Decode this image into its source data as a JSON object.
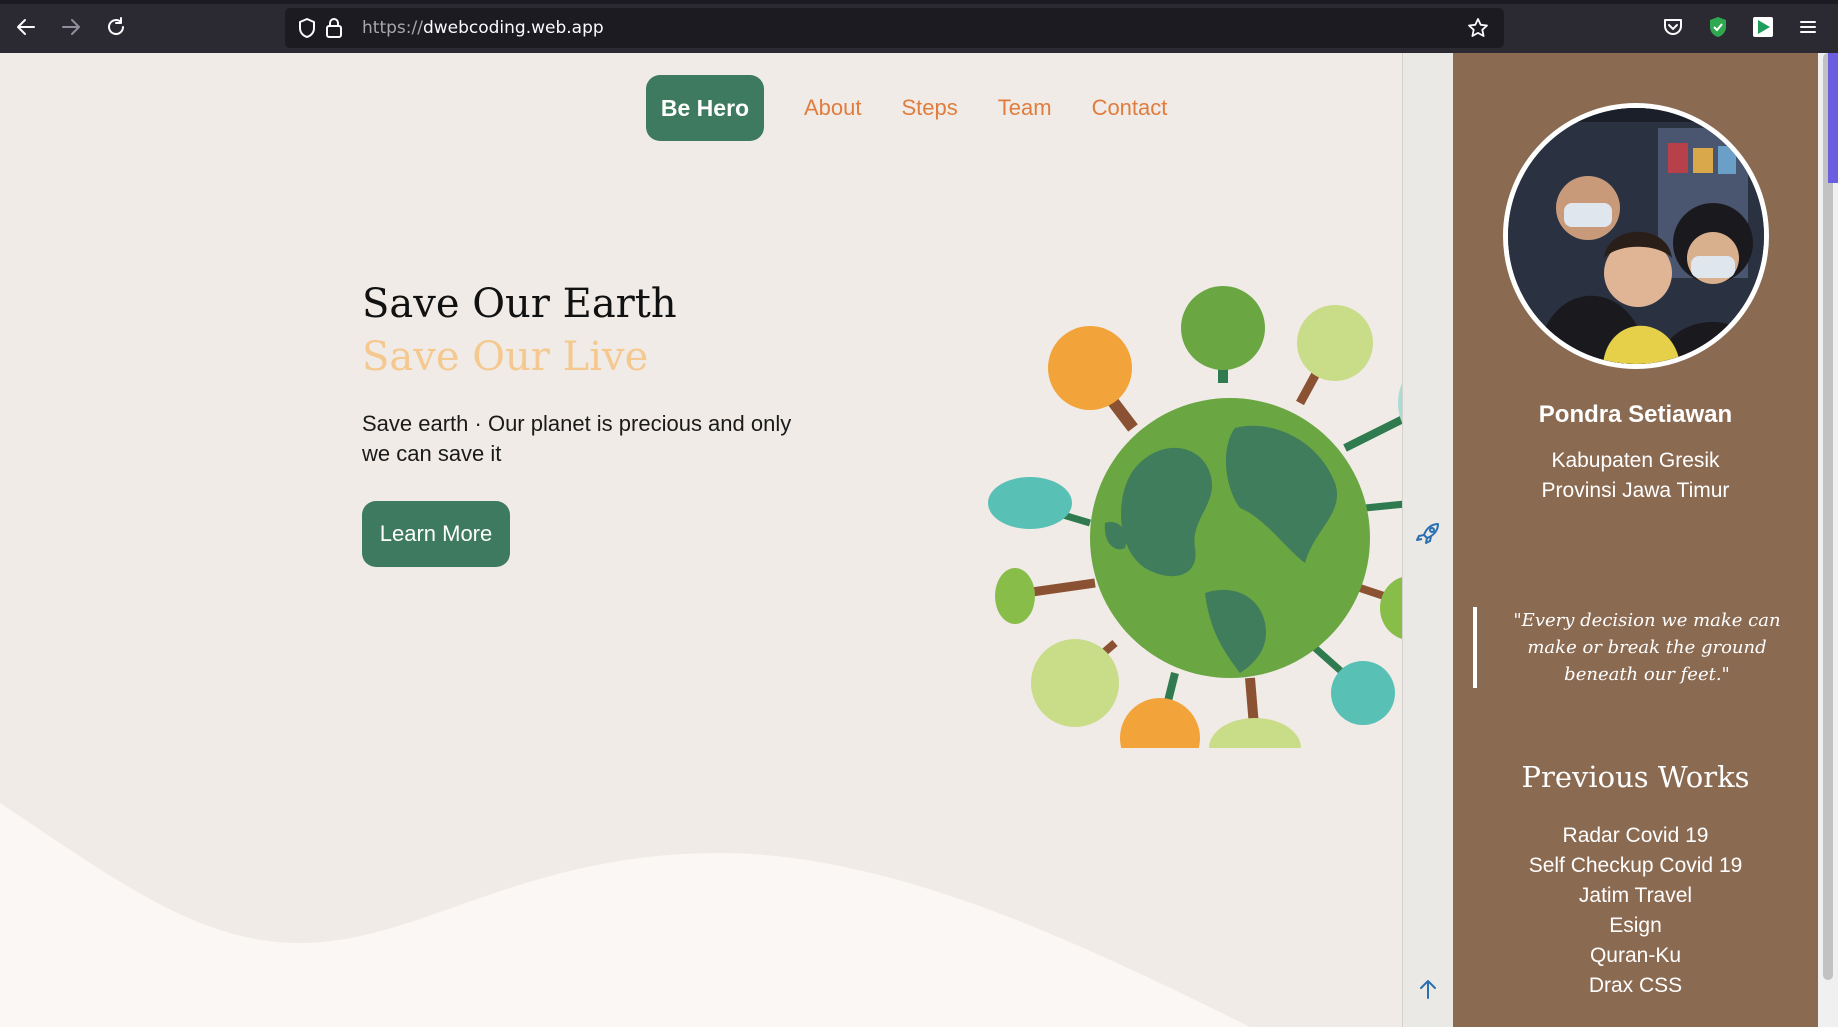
{
  "browser": {
    "url_scheme": "https://",
    "url_host": "dwebcoding.web.app",
    "icons": [
      "back-arrow-icon",
      "forward-arrow-icon",
      "reload-icon",
      "shield-icon",
      "lock-icon",
      "star-icon",
      "pocket-icon",
      "extension-shield-icon",
      "extension-play-icon",
      "menu-icon"
    ]
  },
  "navbar": {
    "brand": "Be Hero",
    "links": [
      "About",
      "Steps",
      "Team",
      "Contact"
    ]
  },
  "hero": {
    "title": "Save Our Earth",
    "subtitle": "Save Our Live",
    "description": "Save earth · Our planet is precious and only we can save it",
    "button": "Learn More"
  },
  "profile": {
    "name": "Pondra Setiawan",
    "location_line1": "Kabupaten Gresik",
    "location_line2": "Provinsi Jawa Timur",
    "quote": "\"Every decision we make can make or break the ground beneath our feet.\"",
    "works_title": "Previous Works",
    "works": [
      "Radar Covid 19",
      "Self Checkup Covid 19",
      "Jatim Travel",
      "Esign",
      "Quran-Ku",
      "Drax CSS"
    ]
  },
  "colors": {
    "accent_green": "#3d7a5f",
    "nav_orange": "#e07d3e",
    "subtitle_peach": "#f4c88e",
    "sidebar_brown": "#8b6a52",
    "page_bg": "#f0ebe6"
  }
}
